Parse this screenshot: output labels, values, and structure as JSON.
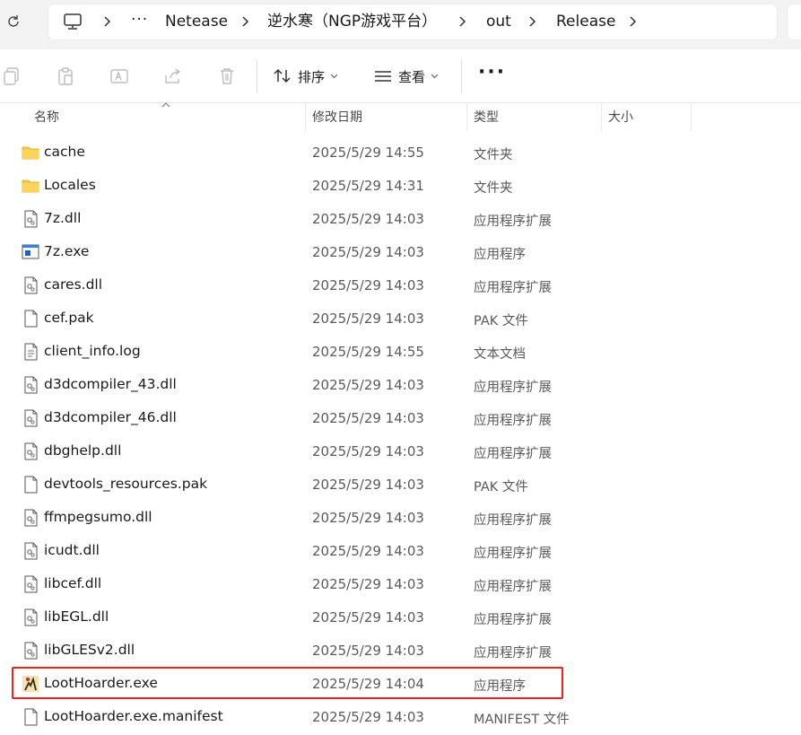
{
  "address_bar": {
    "crumbs": [
      "Netease",
      "逆水寒（NGP游戏平台）",
      "out",
      "Release"
    ],
    "overflow": "···"
  },
  "toolbar": {
    "sort_label": "排序",
    "view_label": "查看",
    "more_label": "···"
  },
  "columns": {
    "name": "名称",
    "date": "修改日期",
    "type": "类型",
    "size": "大小"
  },
  "files": [
    {
      "name": "cache",
      "date": "2025/5/29 14:55",
      "type": "文件夹",
      "icon": "folder-icon"
    },
    {
      "name": "Locales",
      "date": "2025/5/29 14:31",
      "type": "文件夹",
      "icon": "folder-icon"
    },
    {
      "name": "7z.dll",
      "date": "2025/5/29 14:03",
      "type": "应用程序扩展",
      "icon": "dll-icon"
    },
    {
      "name": "7z.exe",
      "date": "2025/5/29 14:03",
      "type": "应用程序",
      "icon": "exe-icon"
    },
    {
      "name": "cares.dll",
      "date": "2025/5/29 14:03",
      "type": "应用程序扩展",
      "icon": "dll-icon"
    },
    {
      "name": "cef.pak",
      "date": "2025/5/29 14:03",
      "type": "PAK 文件",
      "icon": "file-icon"
    },
    {
      "name": "client_info.log",
      "date": "2025/5/29 14:55",
      "type": "文本文档",
      "icon": "text-file-icon"
    },
    {
      "name": "d3dcompiler_43.dll",
      "date": "2025/5/29 14:03",
      "type": "应用程序扩展",
      "icon": "dll-icon"
    },
    {
      "name": "d3dcompiler_46.dll",
      "date": "2025/5/29 14:03",
      "type": "应用程序扩展",
      "icon": "dll-icon"
    },
    {
      "name": "dbghelp.dll",
      "date": "2025/5/29 14:03",
      "type": "应用程序扩展",
      "icon": "dll-icon"
    },
    {
      "name": "devtools_resources.pak",
      "date": "2025/5/29 14:03",
      "type": "PAK 文件",
      "icon": "file-icon"
    },
    {
      "name": "ffmpegsumo.dll",
      "date": "2025/5/29 14:03",
      "type": "应用程序扩展",
      "icon": "dll-icon"
    },
    {
      "name": "icudt.dll",
      "date": "2025/5/29 14:03",
      "type": "应用程序扩展",
      "icon": "dll-icon"
    },
    {
      "name": "libcef.dll",
      "date": "2025/5/29 14:03",
      "type": "应用程序扩展",
      "icon": "dll-icon"
    },
    {
      "name": "libEGL.dll",
      "date": "2025/5/29 14:03",
      "type": "应用程序扩展",
      "icon": "dll-icon"
    },
    {
      "name": "libGLESv2.dll",
      "date": "2025/5/29 14:03",
      "type": "应用程序扩展",
      "icon": "dll-icon"
    },
    {
      "name": "LootHoarder.exe",
      "date": "2025/5/29 14:04",
      "type": "应用程序",
      "icon": "app-exe-icon"
    },
    {
      "name": "LootHoarder.exe.manifest",
      "date": "2025/5/29 14:03",
      "type": "MANIFEST 文件",
      "icon": "file-icon"
    }
  ],
  "colors": {
    "highlight": "#e8241c",
    "folder": "#f7c948"
  }
}
